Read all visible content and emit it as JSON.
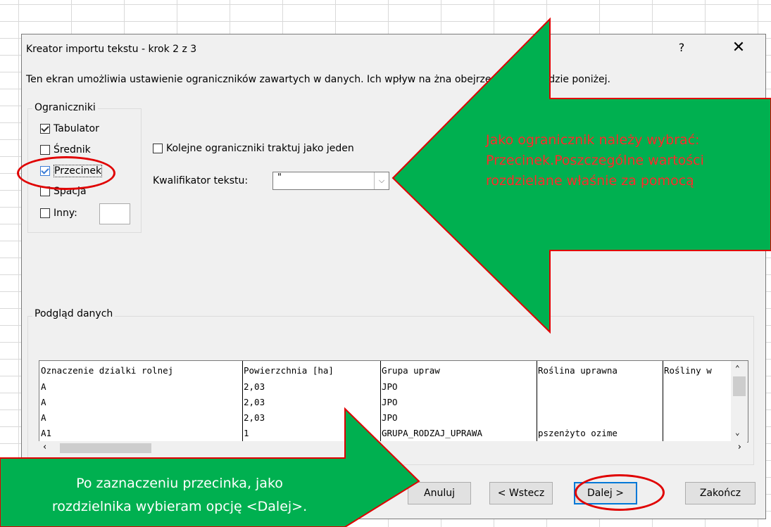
{
  "dialog": {
    "title": "Kreator importu tekstu - krok 2 z 3",
    "help": "?",
    "close": "✕",
    "description": "Ten ekran umożliwia ustawienie ograniczników zawartych w danych. Ich wpływ na          żna obejrzeć na podglądzie poniżej."
  },
  "delimiters": {
    "group_label": "Ograniczniki",
    "tab": "Tabulator",
    "semicolon": "Średnik",
    "comma": "Przecinek",
    "space": "Spacja",
    "other": "Inny:"
  },
  "options": {
    "consecutive": "Kolejne ograniczniki traktuj jako jeden",
    "qualifier_label": "Kwalifikator tekstu:",
    "qualifier_value": "\""
  },
  "preview": {
    "label": "Podgląd danych",
    "headers": [
      "Oznaczenie dzialki rolnej",
      "Powierzchnia [ha]",
      "Grupa upraw",
      "Roślina uprawna",
      "Rośliny w"
    ],
    "rows": [
      [
        "A",
        "2,03",
        "JPO",
        "",
        ""
      ],
      [
        "A",
        "2,03",
        "JPO",
        "",
        ""
      ],
      [
        "A",
        "2,03",
        "JPO",
        "",
        ""
      ],
      [
        "A1",
        "1",
        "GRUPA_RODZAJ_UPRAWA",
        "pszenżyto ozime",
        ""
      ]
    ]
  },
  "buttons": {
    "cancel": "Anuluj",
    "back": "< Wstecz",
    "next": "Dalej >",
    "finish": "Zakończ"
  },
  "annotations": {
    "right_line1": "Jako ogranicznik należy wybrać:",
    "right_line2": "Przecinek.Poszczególne  wartości",
    "right_line3": "rozdzielane  właśnie  za  pomocą",
    "bottom_line1": "Po zaznaczeniu przecinka, jako",
    "bottom_line2": "rozdzielnika wybieram opcję <Dalej>."
  },
  "colors": {
    "arrow_green": "#00b050",
    "highlight_red": "#e00000",
    "annotation_red": "#ff2a2a"
  }
}
